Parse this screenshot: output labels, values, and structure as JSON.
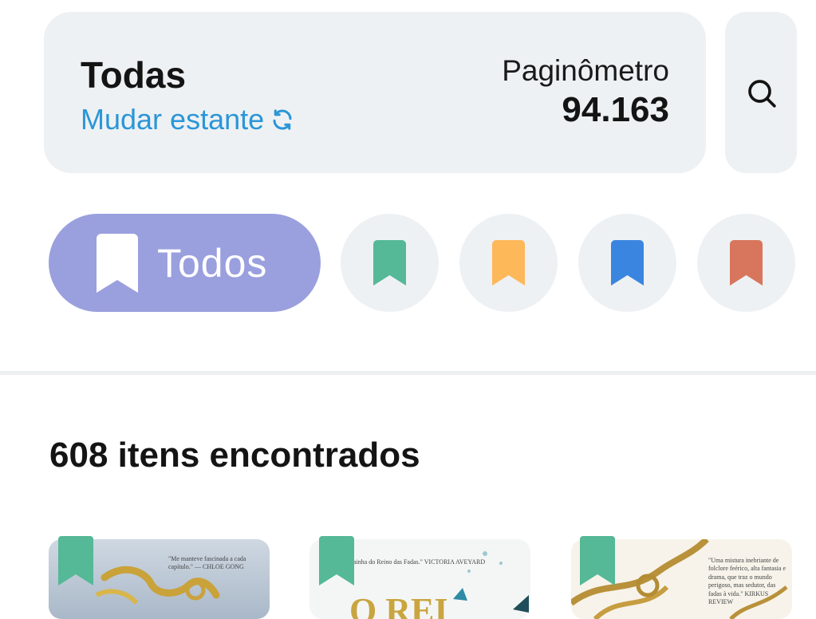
{
  "shelf": {
    "title": "Todas",
    "change_label": "Mudar estante",
    "paginometer_label": "Paginômetro",
    "paginometer_value": "94.163"
  },
  "icons": {
    "search": "search-icon",
    "refresh": "refresh-icon",
    "bookmark": "bookmark-icon"
  },
  "filters": {
    "all_label": "Todos",
    "chips": [
      {
        "name": "green",
        "color": "#55b896"
      },
      {
        "name": "yellow",
        "color": "#fdb85a"
      },
      {
        "name": "blue",
        "color": "#3a85df"
      },
      {
        "name": "orange",
        "color": "#d7765c"
      }
    ]
  },
  "results": {
    "count_text": "608 itens encontrados"
  },
  "books": [
    {
      "quote": "\"Me manteve fascinada a cada capítulo.\" — CHLOE GONG"
    },
    {
      "quote": "da Rainha do Reino das Fadas.\" VICTORIA AVEYARD"
    },
    {
      "quote": "\"Uma mistura inebriante de folclore feérico, alta fantasia e drama, que traz o mundo perigoso, mas sedutor, das fadas à vida.\" KIRKUS REVIEW"
    }
  ]
}
